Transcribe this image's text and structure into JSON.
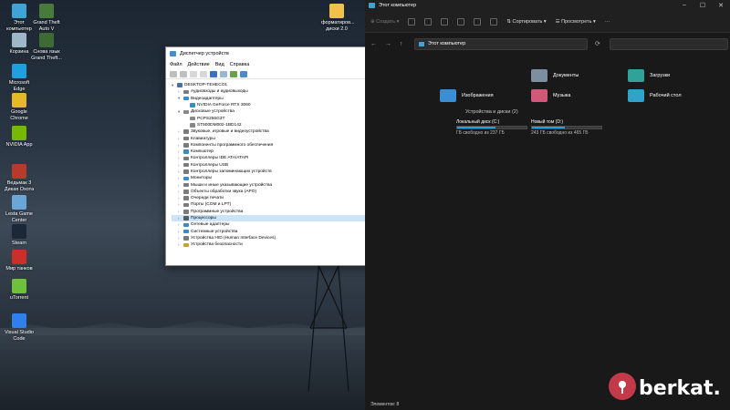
{
  "desktop": {
    "icons": [
      {
        "label": "Этот компьютер",
        "color": "#3fa3d6"
      },
      {
        "label": "Grand Theft Auto V",
        "color": "#4a7a3a"
      },
      {
        "label": "Корзина",
        "color": "#9fb6c9"
      },
      {
        "label": "Снова язык Grand Theft...",
        "color": "#3e6a34"
      },
      {
        "label": "Microsoft Edge",
        "color": "#1f9fe0"
      },
      {
        "label": "Google Chrome",
        "color": "#e6b92b"
      },
      {
        "label": "NVIDIA App",
        "color": "#76b900"
      },
      {
        "label": "Ведьмак 3 Дикая Охота",
        "color": "#b83a2a"
      },
      {
        "label": "Lesta Game Center",
        "color": "#6aa7d8"
      },
      {
        "label": "Steam",
        "color": "#1b2838"
      },
      {
        "label": "Мир танков",
        "color": "#cc2f2a"
      },
      {
        "label": "uTorrent",
        "color": "#6fc13a"
      },
      {
        "label": "Visual Studio Code",
        "color": "#2f80ed"
      },
      {
        "label": "форматиров... диски 2.0",
        "color": "#f0c24a"
      }
    ]
  },
  "device_manager": {
    "title": "Диспетчер устройств",
    "menu": [
      "Файл",
      "Действие",
      "Вид",
      "Справка"
    ],
    "tree": [
      {
        "text": "DESKTOP-TEHECO1",
        "level": 0,
        "arrow": "▾",
        "color": "#4a6fa5"
      },
      {
        "text": "Аудиовходы и аудиовыходы",
        "level": 1,
        "arrow": "›",
        "color": "#7a7a7a"
      },
      {
        "text": "Видеоадаптеры",
        "level": 1,
        "arrow": "▾",
        "color": "#3a8dc4"
      },
      {
        "text": "NVIDIA GeForce RTX 3060",
        "level": 2,
        "arrow": "",
        "color": "#3a8dc4"
      },
      {
        "text": "Дисковые устройства",
        "level": 1,
        "arrow": "▾",
        "color": "#888888"
      },
      {
        "text": "PCPS256G3T",
        "level": 2,
        "arrow": "",
        "color": "#888888"
      },
      {
        "text": "ST500DM002-1BD142",
        "level": 2,
        "arrow": "",
        "color": "#888888"
      },
      {
        "text": "Звуковые, игровые и видеоустройства",
        "level": 1,
        "arrow": "›",
        "color": "#7a7a7a"
      },
      {
        "text": "Клавиатуры",
        "level": 1,
        "arrow": "›",
        "color": "#7a7a7a"
      },
      {
        "text": "Компоненты программного обеспечения",
        "level": 1,
        "arrow": "›",
        "color": "#7a7a7a"
      },
      {
        "text": "Компьютер",
        "level": 1,
        "arrow": "›",
        "color": "#3a8dc4"
      },
      {
        "text": "Контроллеры IDE ATA/ATAPI",
        "level": 1,
        "arrow": "›",
        "color": "#7a7a7a"
      },
      {
        "text": "Контроллеры USB",
        "level": 1,
        "arrow": "›",
        "color": "#7a7a7a"
      },
      {
        "text": "Контроллеры запоминающих устройств",
        "level": 1,
        "arrow": "›",
        "color": "#7a7a7a"
      },
      {
        "text": "Мониторы",
        "level": 1,
        "arrow": "›",
        "color": "#3a8dc4"
      },
      {
        "text": "Мыши и иные указывающие устройства",
        "level": 1,
        "arrow": "›",
        "color": "#7a7a7a"
      },
      {
        "text": "Объекты обработки звука (APO)",
        "level": 1,
        "arrow": "›",
        "color": "#7a7a7a"
      },
      {
        "text": "Очереди печати",
        "level": 1,
        "arrow": "›",
        "color": "#7a7a7a"
      },
      {
        "text": "Порты (COM и LPT)",
        "level": 1,
        "arrow": "›",
        "color": "#7a7a7a"
      },
      {
        "text": "Программные устройства",
        "level": 1,
        "arrow": "›",
        "color": "#7a7a7a"
      },
      {
        "text": "Процессоры",
        "level": 1,
        "arrow": "›",
        "color": "#5a5a5a",
        "selected": true
      },
      {
        "text": "Сетевые адаптеры",
        "level": 1,
        "arrow": "›",
        "color": "#3a8dc4"
      },
      {
        "text": "Системные устройства",
        "level": 1,
        "arrow": "›",
        "color": "#3a8dc4"
      },
      {
        "text": "Устройства HID (Human Interface Devices)",
        "level": 1,
        "arrow": "›",
        "color": "#7a7a7a"
      },
      {
        "text": "Устройства безопасности",
        "level": 1,
        "arrow": "›",
        "color": "#c9a227"
      }
    ]
  },
  "explorer": {
    "title": "Этот компьютер",
    "commands": {
      "create": "Создать",
      "sort": "Сортировать",
      "view": "Просмотреть"
    },
    "address": "Этот компьютер",
    "folders": [
      {
        "label": "Документы",
        "color": "#7d8ea0"
      },
      {
        "label": "Загрузки",
        "color": "#2fa39a"
      },
      {
        "label": "Изображения",
        "color": "#3a8fd4"
      },
      {
        "label": "Музыка",
        "color": "#d2587a"
      },
      {
        "label": "Рабочий стол",
        "color": "#2fa3c9"
      }
    ],
    "drives_header": "Устройства и диски (2)",
    "drives": [
      {
        "name": "Локальный диск (C:)",
        "free": "ГБ свободно из 237 ГБ",
        "fill": 0.55
      },
      {
        "name": "Новый том (D:)",
        "free": "243 ГБ свободно из 465 ГБ",
        "fill": 0.48
      }
    ],
    "status": "Элементов: 8"
  },
  "watermark": {
    "text": "berkat."
  }
}
